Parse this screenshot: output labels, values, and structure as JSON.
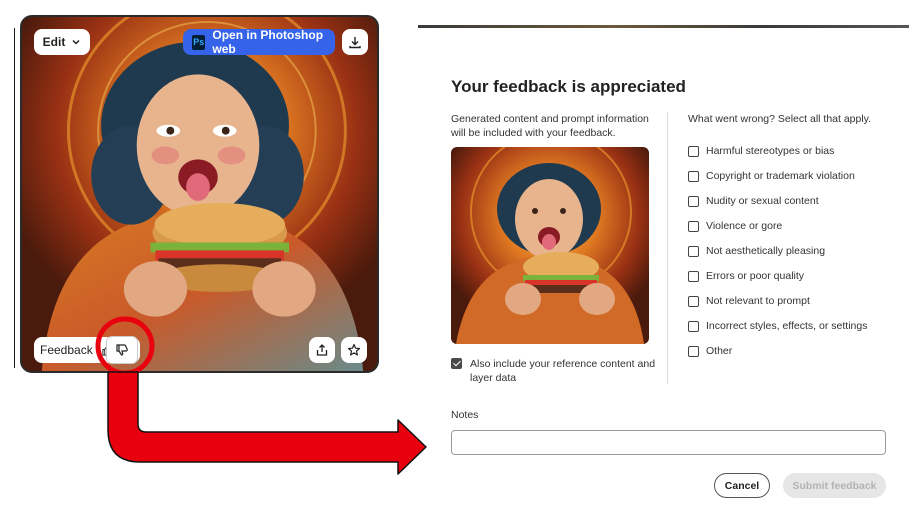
{
  "card": {
    "edit_label": "Edit",
    "photoshop_label": "Open in Photoshop web",
    "photoshop_logo": "Ps",
    "feedback_label": "Feedback"
  },
  "icons": {
    "edit_chevron": "chevron-down-icon",
    "download": "download-icon",
    "thumbs_down": "thumbs-down-icon",
    "thumbs_up": "thumbs-up-icon",
    "share": "share-icon",
    "star": "star-icon"
  },
  "colors": {
    "photoshop_button": "#3563e9",
    "annotation_red": "#e8000f"
  },
  "dialog": {
    "title": "Your feedback is appreciated",
    "description": "Generated content and prompt information will be included with your feedback.",
    "include_label": "Also include your reference content and layer data",
    "include_checked": true,
    "wrong_heading": "What went wrong? Select all that apply.",
    "options": [
      "Harmful stereotypes or bias",
      "Copyright or trademark violation",
      "Nudity or sexual content",
      "Violence or gore",
      "Not aesthetically pleasing",
      "Errors or poor quality",
      "Not relevant to prompt",
      "Incorrect styles, effects, or settings",
      "Other"
    ],
    "notes_label": "Notes",
    "notes_value": "",
    "cancel_label": "Cancel",
    "submit_label": "Submit feedback"
  }
}
